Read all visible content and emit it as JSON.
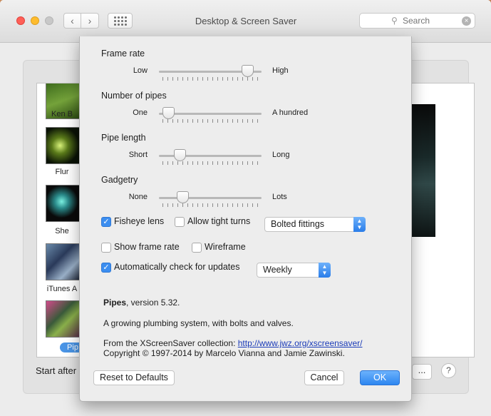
{
  "window": {
    "title": "Desktop & Screen Saver",
    "search_placeholder": "Search"
  },
  "background": {
    "list_items": [
      {
        "label": "Ken B"
      },
      {
        "label": "Flur"
      },
      {
        "label": "She"
      },
      {
        "label": "iTunes A"
      },
      {
        "label": "Pip"
      }
    ],
    "start_after_label": "Start after",
    "dots_button_label": "...",
    "help_label": "?"
  },
  "sheet": {
    "frame_rate": {
      "title": "Frame rate",
      "min_label": "Low",
      "max_label": "High",
      "value": 0.86
    },
    "number_of_pipes": {
      "title": "Number of pipes",
      "min_label": "One",
      "max_label": "A hundred",
      "value": 0.09
    },
    "pipe_length": {
      "title": "Pipe length",
      "min_label": "Short",
      "max_label": "Long",
      "value": 0.2
    },
    "gadgetry": {
      "title": "Gadgetry",
      "min_label": "None",
      "max_label": "Lots",
      "value": 0.23
    },
    "fisheye_lens": {
      "label": "Fisheye lens",
      "checked": true
    },
    "allow_tight_turns": {
      "label": "Allow tight turns",
      "checked": false
    },
    "fittings_select": {
      "value": "Bolted fittings"
    },
    "show_frame_rate": {
      "label": "Show frame rate",
      "checked": false
    },
    "wireframe": {
      "label": "Wireframe",
      "checked": false
    },
    "auto_check_updates": {
      "label": "Automatically check for updates",
      "checked": true
    },
    "update_frequency_select": {
      "value": "Weekly"
    },
    "info": {
      "name": "Pipes",
      "version_text": ", version 5.32.",
      "description": "A growing plumbing system, with bolts and valves.",
      "from_text": "From the XScreenSaver collection: ",
      "link": "http://www.jwz.org/xscreensaver/",
      "copyright": "Copyright © 1997-2014 by Marcelo Vianna and Jamie Zawinski."
    },
    "buttons": {
      "reset": "Reset to Defaults",
      "cancel": "Cancel",
      "ok": "OK"
    }
  }
}
